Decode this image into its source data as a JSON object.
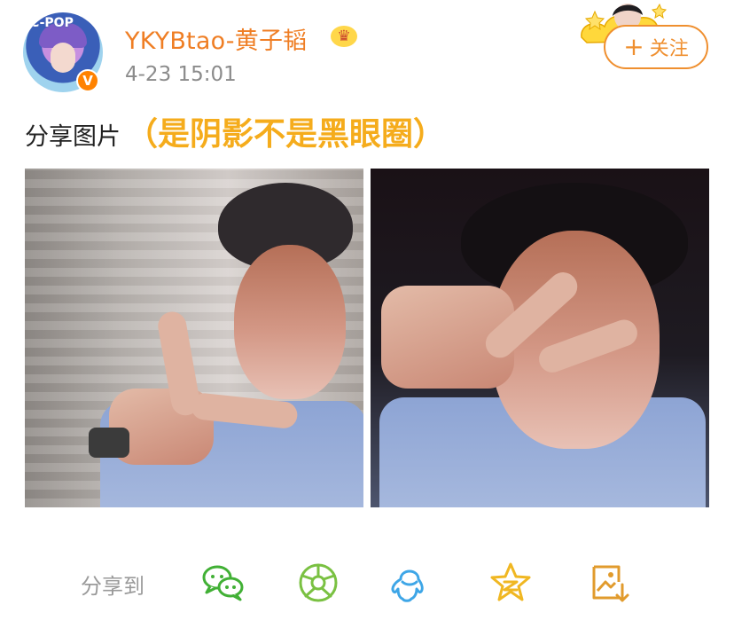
{
  "post": {
    "username": "YKYBtao-黄子韬",
    "timestamp": "4-23 15:01",
    "avatar_badge_text": "C-POP",
    "verified_icon": "V",
    "crown_icon": "crown-icon",
    "share_label": "分享图片",
    "caption_highlight": "（是阴影不是黑眼圈）"
  },
  "actions": {
    "follow_plus": "+",
    "follow_label": "关注",
    "share_to_label": "分享到"
  },
  "icons": [
    "wechat-icon",
    "moments-icon",
    "qq-icon",
    "qzone-icon",
    "save-image-icon"
  ],
  "colors": {
    "accent_orange": "#ef8f2f",
    "username_orange": "#ef7e24",
    "caption_yellow": "#f5ac1c",
    "wechat_green": "#41b035",
    "qq_blue": "#3ea6e7",
    "star_yellow": "#f0b722"
  }
}
